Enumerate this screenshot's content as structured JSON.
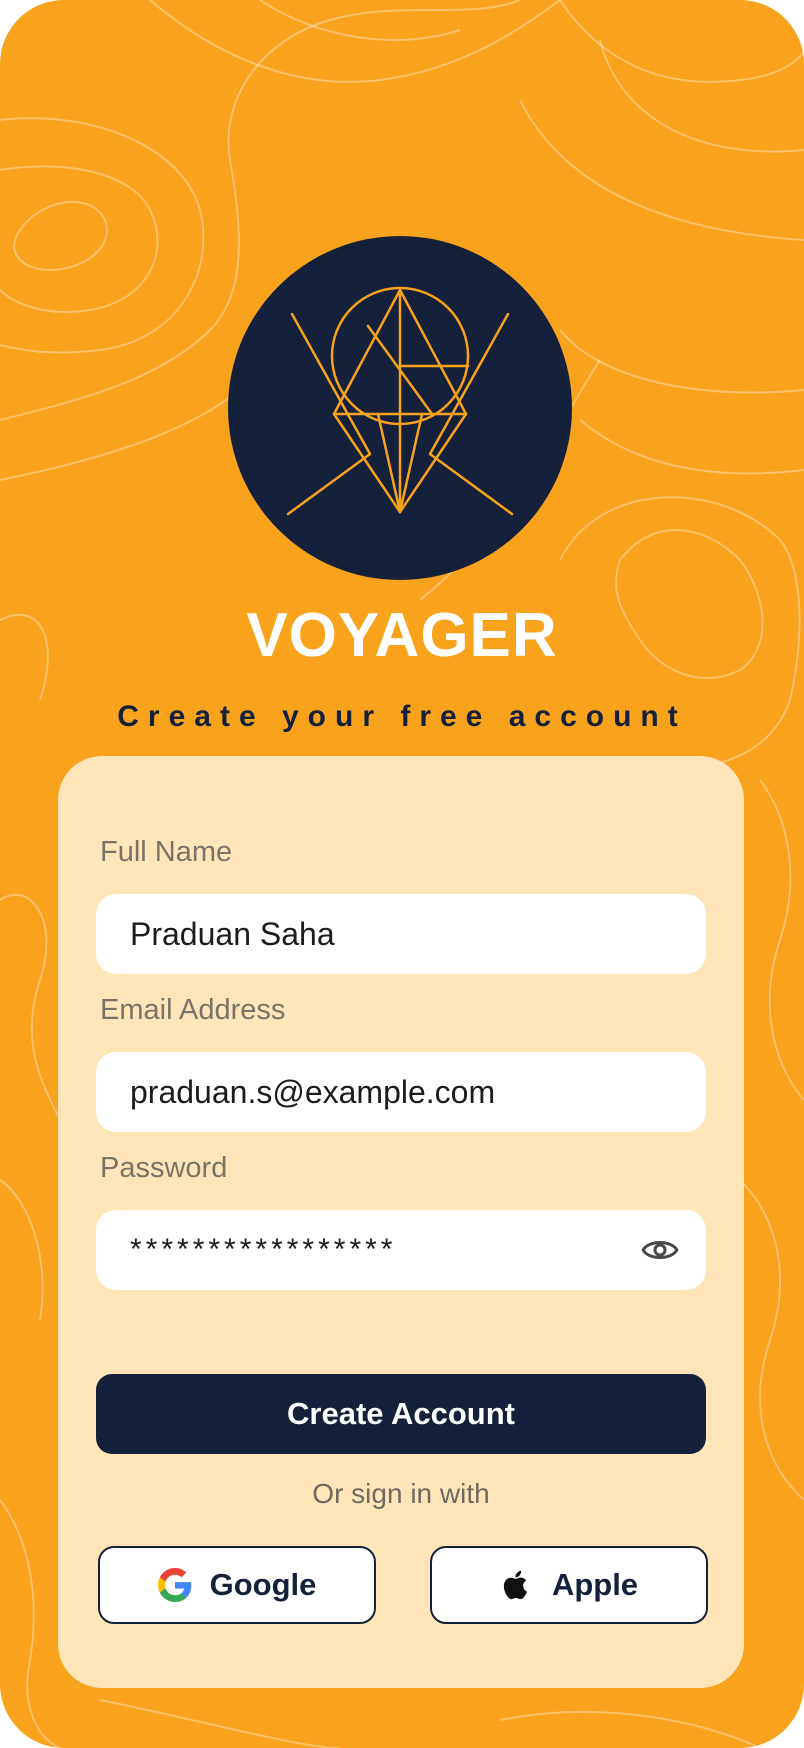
{
  "brand": {
    "name": "VOYAGER",
    "tagline": "Create your free account"
  },
  "form": {
    "full_name": {
      "label": "Full Name",
      "value": "Praduan Saha"
    },
    "email": {
      "label": "Email Address",
      "value": "praduan.s@example.com"
    },
    "password": {
      "label": "Password",
      "value": "*****************"
    }
  },
  "actions": {
    "create_label": "Create Account",
    "alt_signin": "Or sign in with",
    "google_label": "Google",
    "apple_label": "Apple"
  },
  "icons": {
    "logo": "compass-triangle-logo-icon",
    "toggle_password": "eye-icon",
    "google": "google-icon",
    "apple": "apple-icon"
  },
  "colors": {
    "background": "#F9A21B",
    "navy": "#15213B",
    "card": "#FFEECD",
    "white": "#FFFFFF"
  }
}
